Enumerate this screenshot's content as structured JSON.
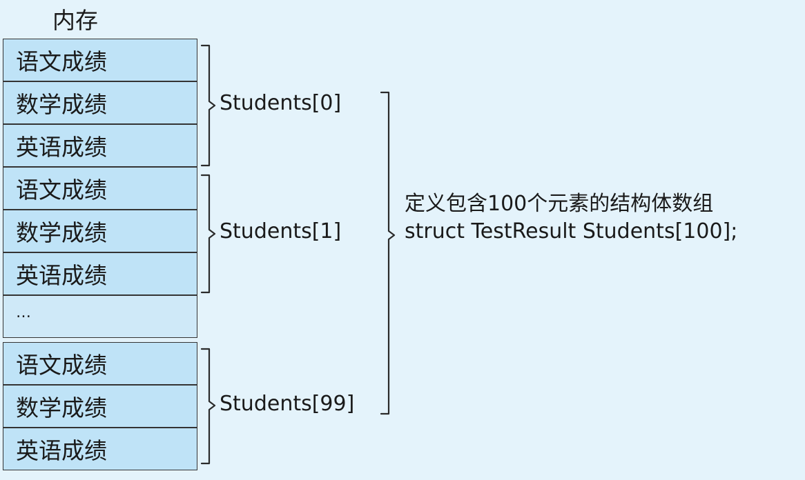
{
  "memory": {
    "title": "内存",
    "cells": [
      "语文成绩",
      "数学成绩",
      "英语成绩",
      "语文成绩",
      "数学成绩",
      "英语成绩",
      "…",
      "语文成绩",
      "数学成绩",
      "英语成绩"
    ]
  },
  "groups": [
    {
      "label": "Students[0]"
    },
    {
      "label": "Students[1]"
    },
    {
      "label": "Students[99]"
    }
  ],
  "description": {
    "line1": "定义包含100个元素的结构体数组",
    "line2": "struct TestResult Students[100];"
  }
}
